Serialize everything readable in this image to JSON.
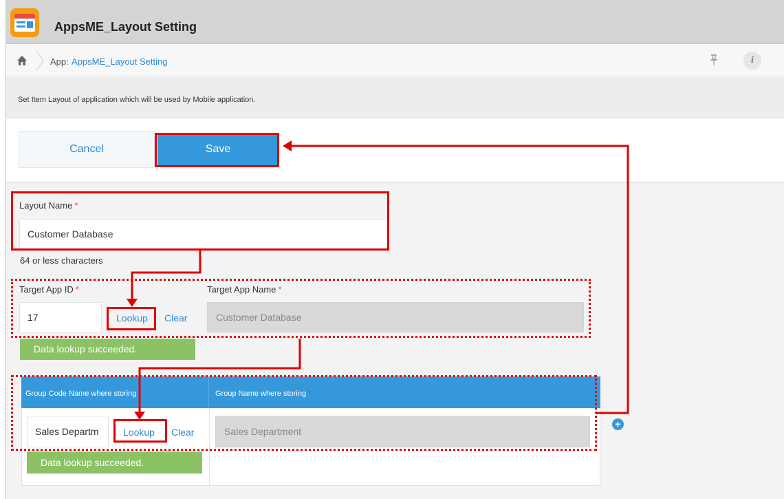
{
  "app": {
    "title": "AppsME_Layout Setting",
    "icon": "layout-app-icon"
  },
  "breadcrumb": {
    "prefix": "App:",
    "link": "AppsME_Layout Setting"
  },
  "description": "Set Item Layout of application which will be used by Mobile application.",
  "actions": {
    "cancel_label": "Cancel",
    "save_label": "Save"
  },
  "layout_name": {
    "label": "Layout Name",
    "required_mark": "*",
    "value": "Customer Database",
    "hint": "64 or less characters"
  },
  "target_app": {
    "id_label": "Target App ID",
    "id_value": "17",
    "name_label": "Target App Name",
    "name_value": "Customer Database",
    "required_mark": "*",
    "lookup_label": "Lookup",
    "clear_label": "Clear",
    "status": "Data lookup succeeded."
  },
  "group": {
    "code_header": "Group Code Name where storing",
    "name_header": "Group Name where storing",
    "required_mark": "*",
    "code_value": "Sales Departm",
    "name_value": "Sales Department",
    "lookup_label": "Lookup",
    "clear_label": "Clear",
    "status": "Data lookup succeeded.",
    "add_symbol": "+"
  },
  "colors": {
    "accent": "#3498db",
    "success": "#8cc266",
    "annotation": "#e00000"
  }
}
